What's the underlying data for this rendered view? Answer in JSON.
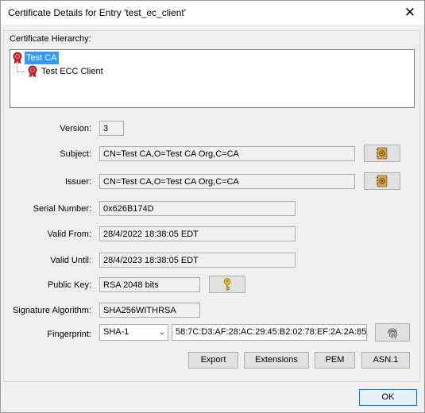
{
  "window": {
    "title": "Certificate Details for Entry 'test_ec_client'",
    "close_symbol": "✕"
  },
  "hierarchy": {
    "label": "Certificate Hierarchy:",
    "items": [
      {
        "label": "Test CA",
        "icon": "certificate-seal-icon",
        "selected": true
      },
      {
        "label": "Test ECC Client",
        "icon": "certificate-seal-icon",
        "selected": false
      }
    ]
  },
  "fields": {
    "version": {
      "label": "Version:",
      "value": "3"
    },
    "subject": {
      "label": "Subject:",
      "value": "CN=Test CA,O=Test CA Org,C=CA",
      "button_icon": "address-book-icon"
    },
    "issuer": {
      "label": "Issuer:",
      "value": "CN=Test CA,O=Test CA Org,C=CA",
      "button_icon": "address-book-icon"
    },
    "serial": {
      "label": "Serial Number:",
      "value": "0x626B174D"
    },
    "valid_from": {
      "label": "Valid From:",
      "value": "28/4/2022 18:38:05 EDT"
    },
    "valid_until": {
      "label": "Valid Until:",
      "value": "28/4/2023 18:38:05 EDT"
    },
    "public_key": {
      "label": "Public Key:",
      "value": "RSA 2048 bits",
      "button_icon": "key-icon"
    },
    "sig_alg": {
      "label": "Signature Algorithm:",
      "value": "SHA256WITHRSA"
    },
    "fingerprint": {
      "label": "Fingerprint:",
      "algorithm": "SHA-1",
      "value": "58:7C:D3:AF:28:AC:29:45:B2:02:78:EF:2A:2A:85",
      "button_icon": "fingerprint-icon"
    }
  },
  "buttons": {
    "export": "Export",
    "extensions": "Extensions",
    "pem": "PEM",
    "asn1": "ASN.1",
    "ok": "OK"
  },
  "colors": {
    "selection": "#3399ff",
    "seal_red": "#c8242b",
    "ok_border": "#0078d7"
  }
}
